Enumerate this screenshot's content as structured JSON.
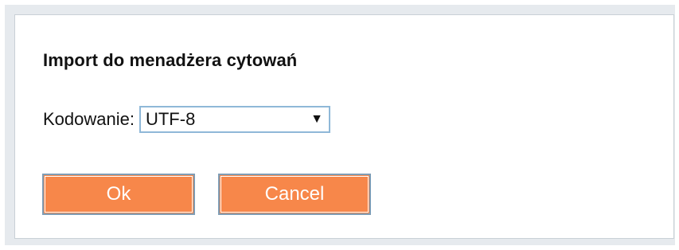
{
  "dialog": {
    "title": "Import do menadżera cytowań",
    "encoding": {
      "label": "Kodowanie:",
      "selected": "UTF-8",
      "arrow_icon": "triangle-down-icon"
    },
    "buttons": {
      "ok_label": "Ok",
      "cancel_label": "Cancel"
    }
  },
  "colors": {
    "button_fill": "#f7874a",
    "button_border": "#7f9db5",
    "select_border": "#8fb8d8",
    "frame_bg": "#e6eaee"
  }
}
